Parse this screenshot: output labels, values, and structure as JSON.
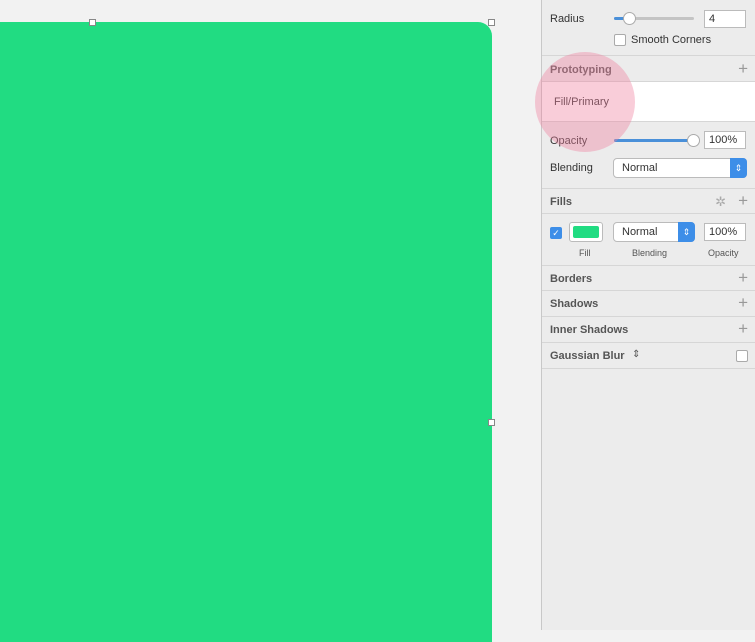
{
  "colors": {
    "fill": "#21dc82",
    "accent": "#3d8ee8",
    "highlight": "#f4a0b8"
  },
  "radius": {
    "label": "Radius",
    "value": "4",
    "slider_fraction": 0.2,
    "smooth_corners_label": "Smooth Corners",
    "smooth_corners_checked": false
  },
  "prototyping": {
    "title": "Prototyping",
    "name_value": "Fill/Primary"
  },
  "opacity": {
    "label": "Opacity",
    "value": "100%",
    "slider_fraction": 1.0
  },
  "blending": {
    "label": "Blending",
    "value": "Normal"
  },
  "fills": {
    "title": "Fills",
    "enabled": true,
    "blend": "Normal",
    "opacity": "100%",
    "captions": {
      "fill": "Fill",
      "blending": "Blending",
      "opacity": "Opacity"
    }
  },
  "sections": {
    "borders": "Borders",
    "shadows": "Shadows",
    "inner_shadows": "Inner Shadows",
    "gaussian_blur": "Gaussian Blur"
  },
  "icons": {
    "add": "+",
    "gear": "✲",
    "updown": "⌃⌄"
  }
}
